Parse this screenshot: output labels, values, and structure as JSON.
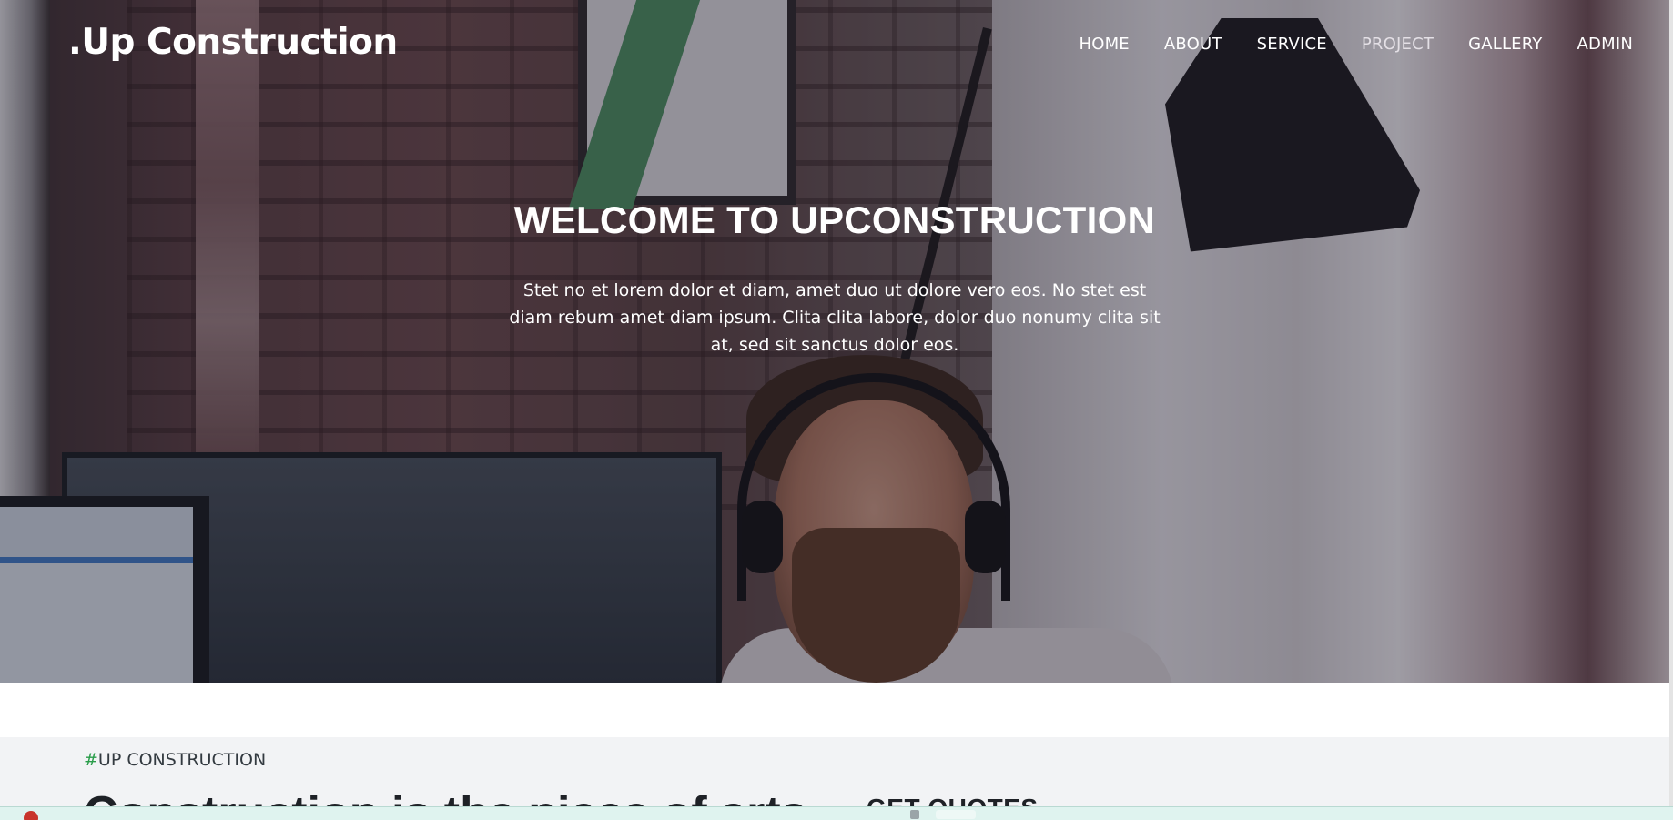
{
  "brand": ".Up Construction",
  "nav": {
    "items": [
      "HOME",
      "ABOUT",
      "SERVICE",
      "PROJECT",
      "GALLERY",
      "ADMIN"
    ]
  },
  "hero": {
    "title": "WELCOME TO UPCONSTRUCTION",
    "text": "Stet no et lorem dolor et diam, amet duo ut dolore vero eos. No stet est diam rebum amet diam ipsum. Clita clita labore, dolor duo nonumy clita sit at, sed sit sanctus dolor eos."
  },
  "section": {
    "tag_hash": "#",
    "tag_text": "UP CONSTRUCTION",
    "headline": "Construction is the piece of arts",
    "quotes_title": "GET QUOTES"
  },
  "colors": {
    "accent": "#2a9d4a",
    "section_bg": "#f2f3f5",
    "heading": "#1e2126"
  }
}
